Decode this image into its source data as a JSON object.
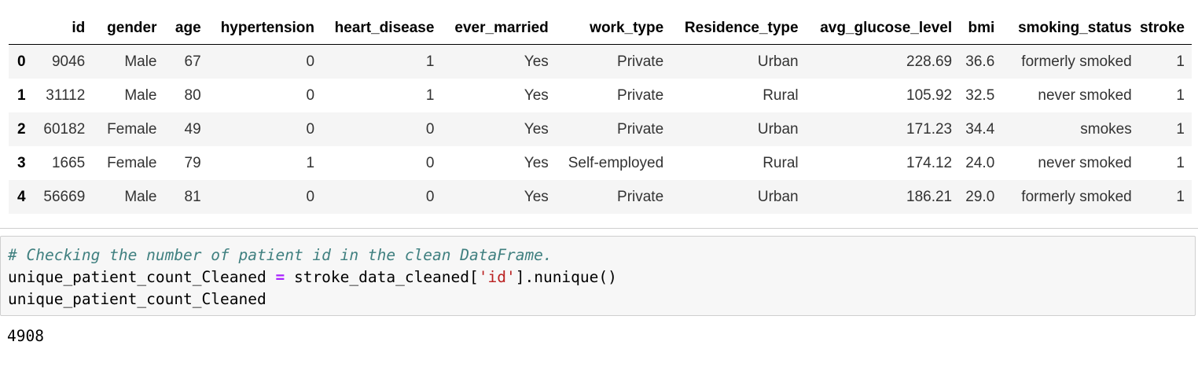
{
  "dataframe": {
    "columns": [
      "",
      "id",
      "gender",
      "age",
      "hypertension",
      "heart_disease",
      "ever_married",
      "work_type",
      "Residence_type",
      "avg_glucose_level",
      "bmi",
      "smoking_status",
      "stroke"
    ],
    "rows": [
      [
        "0",
        "9046",
        "Male",
        "67",
        "0",
        "1",
        "Yes",
        "Private",
        "Urban",
        "228.69",
        "36.6",
        "formerly smoked",
        "1"
      ],
      [
        "1",
        "31112",
        "Male",
        "80",
        "0",
        "1",
        "Yes",
        "Private",
        "Rural",
        "105.92",
        "32.5",
        "never smoked",
        "1"
      ],
      [
        "2",
        "60182",
        "Female",
        "49",
        "0",
        "0",
        "Yes",
        "Private",
        "Urban",
        "171.23",
        "34.4",
        "smokes",
        "1"
      ],
      [
        "3",
        "1665",
        "Female",
        "79",
        "1",
        "0",
        "Yes",
        "Self-employed",
        "Rural",
        "174.12",
        "24.0",
        "never smoked",
        "1"
      ],
      [
        "4",
        "56669",
        "Male",
        "81",
        "0",
        "0",
        "Yes",
        "Private",
        "Urban",
        "186.21",
        "29.0",
        "formerly smoked",
        "1"
      ]
    ]
  },
  "code_cell": {
    "line1_comment": "# Checking the number of patient id in the clean DataFrame.",
    "line2_var": "unique_patient_count_Cleaned ",
    "line2_op": "=",
    "line2_mid": " stroke_data_cleaned[",
    "line2_string": "'id'",
    "line2_end": "].nunique()",
    "line3": "unique_patient_count_Cleaned"
  },
  "output": {
    "value": "4908"
  }
}
